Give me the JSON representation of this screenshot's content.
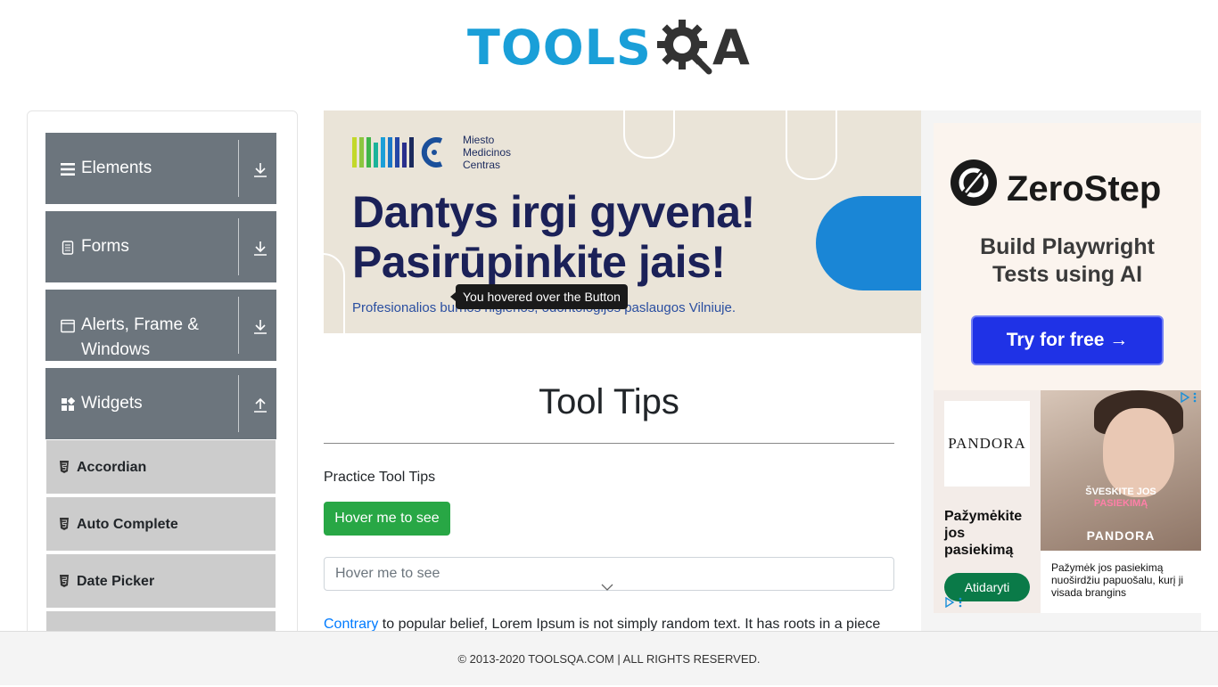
{
  "header": {
    "logo_text_primary": "TOOLS",
    "logo_text_secondary": "A",
    "logo_alt": "TOOLSQA"
  },
  "sidebar": {
    "groups": [
      {
        "label": "Elements",
        "icon": "hamburger-icon",
        "arrow": "download-arrow-icon"
      },
      {
        "label": "Forms",
        "icon": "document-icon",
        "arrow": "download-arrow-icon"
      },
      {
        "label": "Alerts, Frame & Windows",
        "icon": "window-icon",
        "arrow": "download-arrow-icon"
      },
      {
        "label": "Widgets",
        "icon": "widgets-icon",
        "arrow": "upload-arrow-icon"
      }
    ],
    "items": [
      {
        "label": "Accordian",
        "icon": "html5-icon"
      },
      {
        "label": "Auto Complete",
        "icon": "html5-icon"
      },
      {
        "label": "Date Picker",
        "icon": "html5-icon"
      }
    ]
  },
  "banner": {
    "brand_line1": "Miesto",
    "brand_line2": "Medicinos",
    "brand_line3": "Centras",
    "headline_line1": "Dantys irgi gyvena!",
    "headline_line2": "Pasirūpinkite jais!",
    "subtext": "Profesionalios burnos higienos, odontologijos paslaugos Vilniuje."
  },
  "tooltip": {
    "text": "You hovered over the Button"
  },
  "main": {
    "title": "Tool Tips",
    "subtitle": "Practice Tool Tips",
    "hover_button_label": "Hover me to see",
    "hover_input_placeholder": "Hover me to see",
    "paragraph_link": "Contrary",
    "paragraph_text": " to popular belief, Lorem Ipsum is not simply random text. It has roots in a piece"
  },
  "ads": {
    "zerostep": {
      "brand": "ZeroStep",
      "tagline_line1": "Build Playwright",
      "tagline_line2": "Tests using AI",
      "cta": "Try for free →"
    },
    "pandora": {
      "logo": "PANDORA",
      "headline": "Pažymėkite jos pasiekimą",
      "cta": "Atidaryti",
      "image_slogan_line1": "ŠVESKITE JOS",
      "image_slogan_line2": "PASIEKIMĄ",
      "image_logo": "PANDORA",
      "body": "Pažymėk jos pasiekimą nuoširdžiu papuošalu, kurį ji visada brangins"
    }
  },
  "footer": {
    "text": "© 2013-2020 TOOLSQA.COM | ALL RIGHTS RESERVED."
  },
  "colors": {
    "logo_blue": "#1a9fd8",
    "sidebar_group": "#6c757d",
    "sidebar_item": "#cccccc",
    "success_green": "#28a745",
    "link_blue": "#007bff",
    "zerostep_button": "#1f32e6",
    "pandora_green": "#0a7a48"
  }
}
